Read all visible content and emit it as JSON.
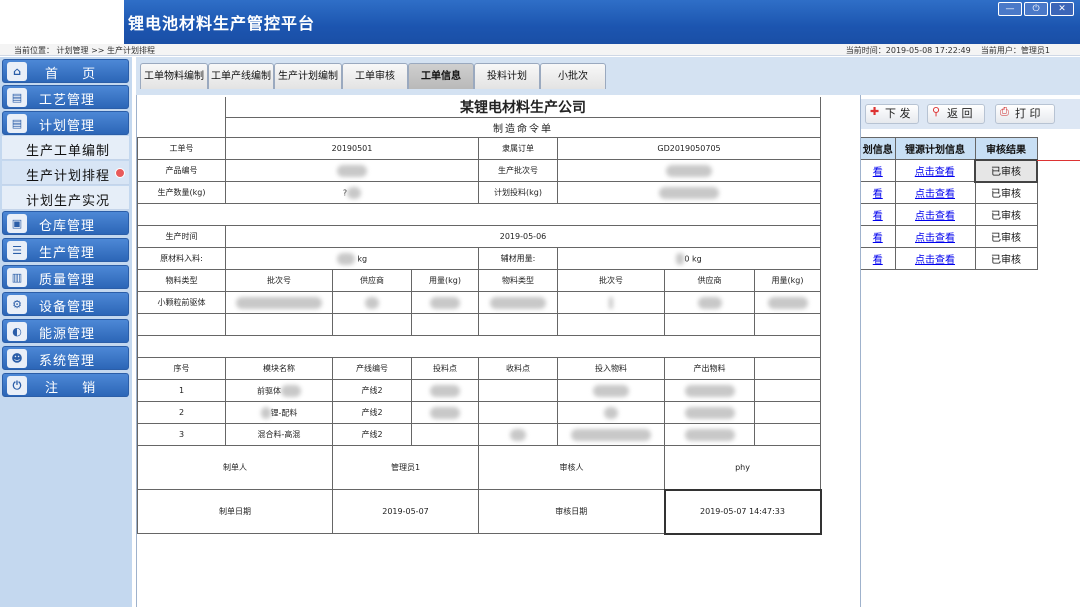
{
  "app": {
    "title": "锂电池材料生产管控平台"
  },
  "window_controls": [
    "—",
    "⏻",
    "✕"
  ],
  "status": {
    "location_label": "当前位置：",
    "location_path": "计划管理",
    "separator": ">>",
    "location_page": "生产计划排程",
    "time_label": "当前时间：",
    "time_value": "2019-05-08 17:22:49",
    "user_label": "当前用户：",
    "user_value": "管理员1"
  },
  "sidebar": {
    "items": [
      {
        "label": "首 页",
        "icon": "home-icon"
      },
      {
        "label": "工艺管理",
        "icon": "document-icon"
      },
      {
        "label": "计划管理",
        "icon": "document-icon"
      },
      {
        "label": "生产工单编制"
      },
      {
        "label": "生产计划排程"
      },
      {
        "label": "计划生产实况"
      },
      {
        "label": "仓库管理",
        "icon": "warehouse-icon"
      },
      {
        "label": "生产管理",
        "icon": "list-icon"
      },
      {
        "label": "质量管理",
        "icon": "chart-icon"
      },
      {
        "label": "设备管理",
        "icon": "gear-icon"
      },
      {
        "label": "能源管理",
        "icon": "energy-icon"
      },
      {
        "label": "系统管理",
        "icon": "users-icon"
      },
      {
        "label": "注 销",
        "icon": "power-icon"
      }
    ]
  },
  "tabs": [
    "工单物料编制",
    "工单产线编制",
    "生产计划编制",
    "工单审核",
    "工单信息",
    "投料计划",
    "小批次"
  ],
  "toolbar": {
    "issue": "下 发",
    "back": "返 回",
    "print": "打 印"
  },
  "right_table": {
    "headers": [
      "划信息",
      "锂源计划信息",
      "审核结果"
    ],
    "rows": [
      [
        "看",
        "点击查看",
        "已审核"
      ],
      [
        "看",
        "点击查看",
        "已审核"
      ],
      [
        "看",
        "点击查看",
        "已审核"
      ],
      [
        "看",
        "点击查看",
        "已审核"
      ],
      [
        "看",
        "点击查看",
        "已审核"
      ]
    ]
  },
  "doc": {
    "company": "某锂电材料生产公司",
    "subtitle": "制造命令单",
    "order_no_label": "工单号",
    "order_no": "20190501",
    "belong_order_label": "隶属订单",
    "belong_order": "GD2019050705",
    "product_no_label": "产品编号",
    "batch_no_label": "生产批次号",
    "qty_label": "生产数量(kg)",
    "qty_value": "?",
    "plan_feed_label": "计划投料(kg)",
    "prod_time_label": "生产时间",
    "prod_time": "2019-05-06",
    "raw_in_label": "原材料入料:",
    "raw_in_unit": "kg",
    "aux_label": "辅材用量:",
    "aux_unit": "0 kg",
    "mat_headers": [
      "物料类型",
      "批次号",
      "供应商",
      "用量(kg)",
      "物料类型",
      "批次号",
      "供应商",
      "用量(kg)"
    ],
    "mat_row1_type": "小颗粒前驱体",
    "step_headers": [
      "序号",
      "模块名称",
      "产线编号",
      "投料点",
      "收料点",
      "投入物料",
      "产出物料"
    ],
    "steps": [
      {
        "no": "1",
        "module": "前驱体",
        "line": "产线2"
      },
      {
        "no": "2",
        "module": "锂-配料",
        "line": "产线2"
      },
      {
        "no": "3",
        "module": "混合料-高混",
        "line": "产线2"
      }
    ],
    "maker_label": "制单人",
    "maker": "管理员1",
    "reviewer_label": "审核人",
    "reviewer": "phy",
    "make_date_label": "制单日期",
    "make_date": "2019-05-07",
    "review_date_label": "审核日期",
    "review_date": "2019-05-07 14:47:33"
  }
}
